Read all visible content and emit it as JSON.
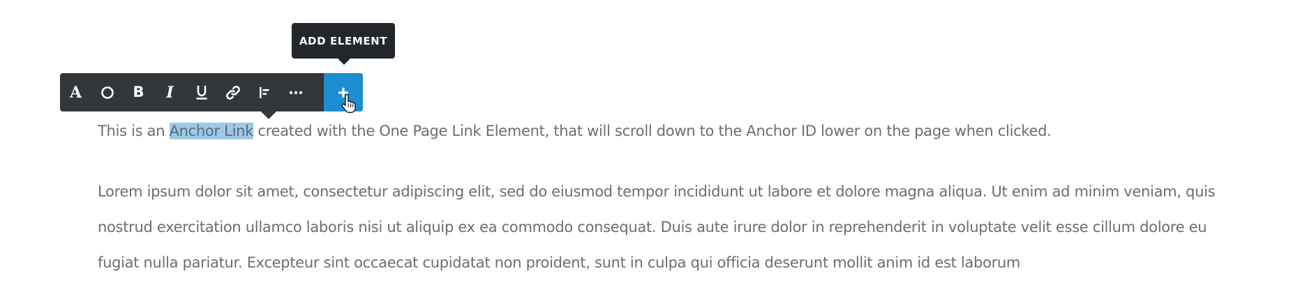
{
  "tooltip": {
    "label": "ADD ELEMENT"
  },
  "toolbar": {
    "buttons": [
      {
        "name": "font-style",
        "glyph": "A"
      },
      {
        "name": "text-color",
        "glyph": "circle"
      },
      {
        "name": "bold",
        "glyph": "B"
      },
      {
        "name": "italic",
        "glyph": "I"
      },
      {
        "name": "underline",
        "glyph": "U"
      },
      {
        "name": "link",
        "glyph": "link"
      },
      {
        "name": "align",
        "glyph": "align-left"
      },
      {
        "name": "more",
        "glyph": "ellipsis"
      },
      {
        "name": "add-element",
        "glyph": "plus"
      }
    ],
    "glyph_A": "A",
    "glyph_B": "B",
    "glyph_I": "I",
    "accent_color": "#1d8dd1",
    "bar_color": "#32373c"
  },
  "content": {
    "p1_before": "This is an ",
    "p1_selected": "Anchor Link",
    "p1_after": " created with the One Page Link Element, that will scroll down to the Anchor ID lower on the page when clicked.",
    "p2": "Lorem ipsum dolor sit amet, consectetur adipiscing elit, sed do eiusmod tempor incididunt ut labore et dolore magna aliqua. Ut enim ad minim veniam, quis nostrud exercitation ullamco laboris nisi ut aliquip ex ea commodo consequat. Duis aute irure dolor in reprehenderit in voluptate velit esse cillum dolore eu fugiat nulla pariatur. Excepteur sint occaecat cupidatat non proident, sunt in culpa qui officia deserunt mollit anim id est laborum",
    "highlight_color": "#9fc8e6"
  }
}
